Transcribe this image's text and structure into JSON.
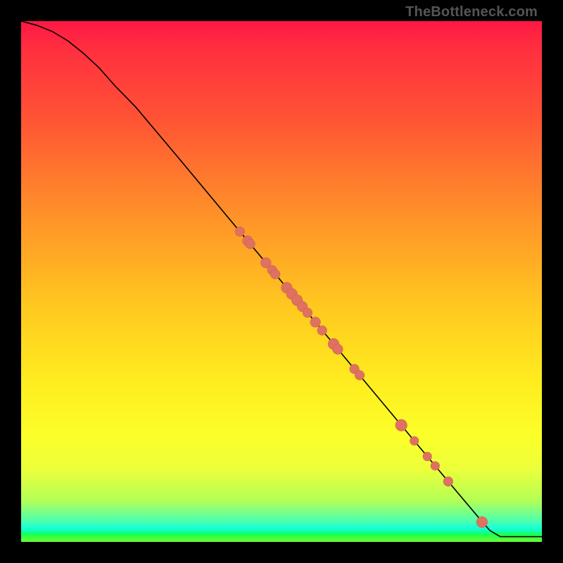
{
  "watermark": "TheBottleneck.com",
  "chart_data": {
    "type": "line",
    "title": "",
    "xlabel": "",
    "ylabel": "",
    "xlim": [
      0,
      100
    ],
    "ylim": [
      0,
      100
    ],
    "curve": {
      "x": [
        0,
        3,
        6,
        9,
        12,
        15,
        18,
        22,
        30,
        40,
        50,
        60,
        70,
        80,
        88,
        90,
        92,
        100
      ],
      "y": [
        100,
        99.2,
        98.0,
        96.2,
        93.8,
        91.0,
        87.6,
        83.5,
        74.0,
        62.0,
        50.0,
        38.0,
        26.0,
        14.0,
        4.5,
        2.2,
        1.0,
        1.0
      ]
    },
    "series": [
      {
        "name": "points",
        "type": "scatter",
        "x": [
          42.0,
          43.5,
          44.0,
          47.0,
          48.2,
          48.8,
          51.0,
          52.0,
          53.0,
          54.0,
          55.0,
          56.5,
          57.8,
          60.0,
          60.8,
          64.0,
          65.0,
          73.0,
          75.5,
          78.0,
          79.5,
          82.0,
          88.5
        ],
        "y": [
          59.6,
          57.8,
          57.2,
          53.6,
          52.2,
          51.4,
          48.8,
          47.6,
          46.4,
          45.2,
          44.0,
          42.2,
          40.6,
          38.0,
          37.0,
          33.2,
          32.0,
          22.4,
          19.4,
          16.4,
          14.6,
          11.6,
          3.8
        ],
        "r": [
          7,
          7.5,
          7,
          7.5,
          7,
          7,
          8,
          8,
          8,
          7.5,
          7,
          7.5,
          7,
          8,
          7.5,
          7,
          7,
          8.5,
          6.5,
          6.5,
          6.5,
          7,
          8
        ]
      }
    ]
  }
}
